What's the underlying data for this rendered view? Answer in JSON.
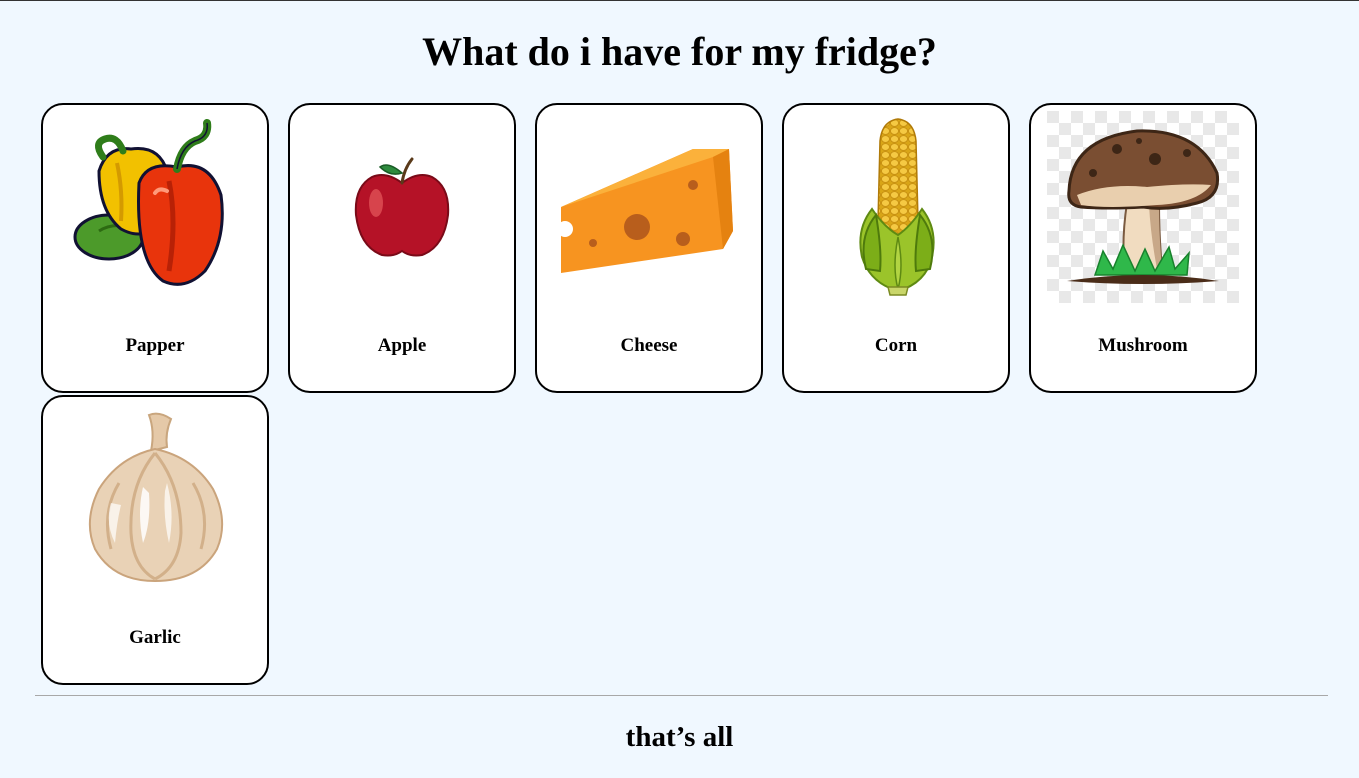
{
  "page": {
    "title": "What do i have for my fridge?",
    "footer": "that’s all"
  },
  "items": [
    {
      "label": "Papper",
      "icon": "bell-pepper-icon"
    },
    {
      "label": "Apple",
      "icon": "apple-icon"
    },
    {
      "label": "Cheese",
      "icon": "cheese-icon"
    },
    {
      "label": "Corn",
      "icon": "corn-icon"
    },
    {
      "label": "Mushroom",
      "icon": "mushroom-icon"
    },
    {
      "label": "Garlic",
      "icon": "garlic-icon"
    }
  ],
  "colors": {
    "background": "#f0f8ff",
    "card_background": "#ffffff",
    "card_border": "#000000",
    "divider": "#a8a8a8"
  }
}
